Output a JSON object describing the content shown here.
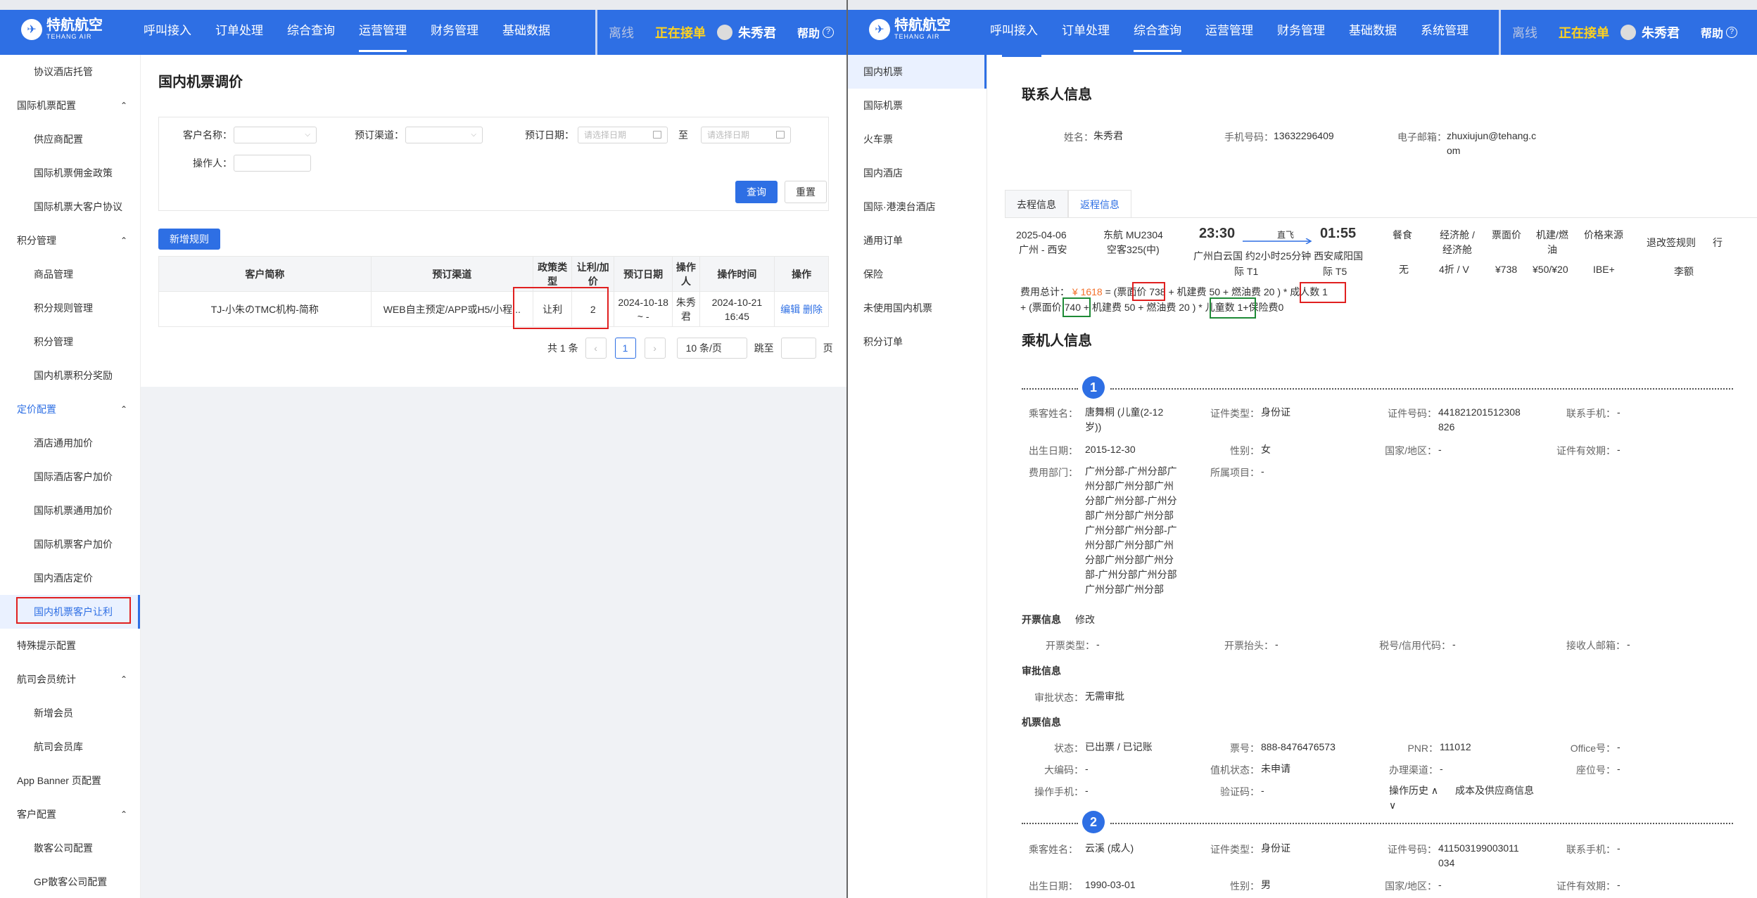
{
  "left": {
    "nav": {
      "logo_main": "特航航空",
      "logo_sub": "TEHANG AIR",
      "menu": [
        "呼叫接入",
        "订单处理",
        "综合查询",
        "运营管理",
        "财务管理",
        "基础数据"
      ],
      "active_menu": "运营管理",
      "offline": "离线",
      "online": "正在接单",
      "user": "朱秀君",
      "help": "帮助"
    },
    "sidebar": [
      {
        "label": "协议酒店托管",
        "type": "item"
      },
      {
        "label": "国际机票配置",
        "type": "group"
      },
      {
        "label": "供应商配置",
        "type": "item"
      },
      {
        "label": "国际机票佣金政策",
        "type": "item"
      },
      {
        "label": "国际机票大客户协议",
        "type": "item"
      },
      {
        "label": "积分管理",
        "type": "group"
      },
      {
        "label": "商品管理",
        "type": "item"
      },
      {
        "label": "积分规则管理",
        "type": "item"
      },
      {
        "label": "积分管理",
        "type": "item"
      },
      {
        "label": "国内机票积分奖励",
        "type": "item"
      },
      {
        "label": "定价配置",
        "type": "group-active"
      },
      {
        "label": "酒店通用加价",
        "type": "item"
      },
      {
        "label": "国际酒店客户加价",
        "type": "item"
      },
      {
        "label": "国际机票通用加价",
        "type": "item"
      },
      {
        "label": "国际机票客户加价",
        "type": "item"
      },
      {
        "label": "国内酒店定价",
        "type": "item"
      },
      {
        "label": "国内机票客户让利",
        "type": "item-active"
      },
      {
        "label": "特殊提示配置",
        "type": "plain"
      },
      {
        "label": "航司会员统计",
        "type": "group"
      },
      {
        "label": "新增会员",
        "type": "item"
      },
      {
        "label": "航司会员库",
        "type": "item"
      },
      {
        "label": "App Banner 页配置",
        "type": "plain"
      },
      {
        "label": "客户配置",
        "type": "group"
      },
      {
        "label": "散客公司配置",
        "type": "item"
      },
      {
        "label": "GP散客公司配置",
        "type": "item"
      }
    ],
    "page_title": "国内机票调价",
    "filter": {
      "customer_label": "客户名称：",
      "channel_label": "预订渠道：",
      "date_label": "预订日期：",
      "date_placeholder": "请选择日期",
      "to": "至",
      "operator_label": "操作人：",
      "query": "查询",
      "reset": "重置"
    },
    "add_rule": "新增规则",
    "table": {
      "headers": [
        "客户简称",
        "预订渠道",
        "政策类型",
        "让利/加价",
        "预订日期",
        "操作人",
        "操作时间",
        "操作"
      ],
      "row": {
        "customer": "TJ-小朱のTMC机构-简称",
        "channel": "WEB自主预定/APP或H5/小程...",
        "policy": "让利",
        "amount": "2",
        "date": "2024-10-18 ~ -",
        "operator": "朱秀君",
        "op_time": "2024-10-21 16:45",
        "edit": "编辑",
        "delete": "删除"
      }
    },
    "pager": {
      "total": "共 1 条",
      "page": "1",
      "size": "10 条/页",
      "goto": "跳至",
      "page_suffix": "页"
    }
  },
  "right": {
    "nav": {
      "menu": [
        "呼叫接入",
        "订单处理",
        "综合查询",
        "运营管理",
        "财务管理",
        "基础数据",
        "系统管理"
      ],
      "active_menu": "综合查询",
      "offline": "离线",
      "online": "正在接单",
      "user": "朱秀君",
      "help": "帮助"
    },
    "sidebar": [
      "国内机票",
      "国际机票",
      "火车票",
      "国内酒店",
      "国际·港澳台酒店",
      "通用订单",
      "保险",
      "未使用国内机票",
      "积分订单"
    ],
    "active_side": "国内机票",
    "contact": {
      "title": "联系人信息",
      "name_k": "姓名：",
      "name_v": "朱秀君",
      "phone_k": "手机号码：",
      "phone_v": "13632296409",
      "email_k": "电子邮箱：",
      "email_v1": "zhuxiujun@tehang.c",
      "email_v2": "om"
    },
    "tabs": [
      "去程信息",
      "返程信息"
    ],
    "flight": {
      "date": "2025-04-06",
      "route": "广州 - 西安",
      "airline": "东航 MU2304",
      "aircraft": "空客325(中)",
      "dep_time": "23:30",
      "arr_time": "01:55",
      "direct": "直飞",
      "duration_line": "广州白云国 约2小时25分钟 西安咸阳国",
      "dep_term": "际 T1",
      "arr_term": "际 T5",
      "meal_h": "餐食",
      "meal_v": "无",
      "cabin_h1": "经济舱 /",
      "cabin_h2": "经济舱",
      "cabin_v": "4折 / V",
      "price_h": "票面价",
      "price_v": "¥738",
      "tax_h1": "机建/燃",
      "tax_h2": "油",
      "tax_v": "¥50/¥20",
      "src_h": "价格来源",
      "src_v": "IBE+",
      "rule": "退改签规则",
      "luggage1": "行",
      "luggage2": "李额"
    },
    "fee": {
      "label": "费用总计：",
      "total": "¥ 1618",
      "l1_a": "= (票面",
      "l1_b": "价 738",
      "l1_c": "+ 机建费 50 + 燃油费 20 ) *",
      "l1_d": "成人数 1",
      "l2_a": "+ (票面价",
      "l2_b": "740",
      "l2_c": "+ 机建费 50 + 燃油费 20 ) *",
      "l2_d": "儿童数 1",
      "l2_e": "+保险费0"
    },
    "passengers_title": "乘机人信息",
    "p1": {
      "no": "1",
      "name_k": "乘客姓名：",
      "name_v1": "唐舞桐 (儿童(2-12",
      "name_v2": "岁))",
      "idtype_k": "证件类型：",
      "idtype_v": "身份证",
      "idno_k": "证件号码：",
      "idno_v1": "441821201512308",
      "idno_v2": "826",
      "mobile_k": "联系手机：",
      "mobile_v": "-",
      "birth_k": "出生日期：",
      "birth_v": "2015-12-30",
      "gender_k": "性别：",
      "gender_v": "女",
      "country_k": "国家/地区：",
      "country_v": "-",
      "valid_k": "证件有效期：",
      "valid_v": "-",
      "dept_k": "费用部门：",
      "dept_lines": [
        "广州分部-广州分部广",
        "州分部广州分部广州",
        "分部广州分部-广州分",
        "部广州分部广州分部",
        "广州分部广州分部-广",
        "州分部广州分部广州",
        "分部广州分部广州分",
        "部-广州分部广州分部",
        "广州分部广州分部"
      ],
      "project_k": "所属项目：",
      "project_v": "-"
    },
    "invoice": {
      "title": "开票信息",
      "edit": "修改",
      "type_k": "开票类型：",
      "type_v": "-",
      "head_k": "开票抬头：",
      "head_v": "-",
      "tax_k": "税号/信用代码：",
      "tax_v": "-",
      "mail_k": "接收人邮箱：",
      "mail_v": "-"
    },
    "approval": {
      "title": "审批信息",
      "status_k": "审批状态：",
      "status_v": "无需审批"
    },
    "ticket": {
      "title": "机票信息",
      "state_k": "状态：",
      "state_v": "已出票 / 已记账",
      "tno_k": "票号：",
      "tno_v": "888-8476476573",
      "pnr_k": "PNR：",
      "pnr_v": "111012",
      "office_k": "Office号：",
      "office_v": "-",
      "big_k": "大编码：",
      "big_v": "-",
      "checkin_k": "值机状态：",
      "checkin_v": "未申请",
      "chan_k": "办理渠道：",
      "chan_v": "-",
      "seat_k": "座位号：",
      "seat_v": "-",
      "opm_k": "操作手机：",
      "opm_v": "-",
      "code_k": "验证码：",
      "code_v": "-",
      "history": "操作历史",
      "cost": "成本及供应商信息"
    },
    "p2": {
      "no": "2",
      "name_k": "乘客姓名：",
      "name_v": "云溪 (成人)",
      "idtype_k": "证件类型：",
      "idtype_v": "身份证",
      "idno_k": "证件号码：",
      "idno_v1": "411503199003011",
      "idno_v2": "034",
      "mobile_k": "联系手机：",
      "mobile_v": "-",
      "birth_k": "出生日期：",
      "birth_v": "1990-03-01",
      "gender_k": "性别：",
      "gender_v": "男",
      "country_k": "国家/地区：",
      "country_v": "-",
      "valid_k": "证件有效期：",
      "valid_v": "-"
    }
  }
}
